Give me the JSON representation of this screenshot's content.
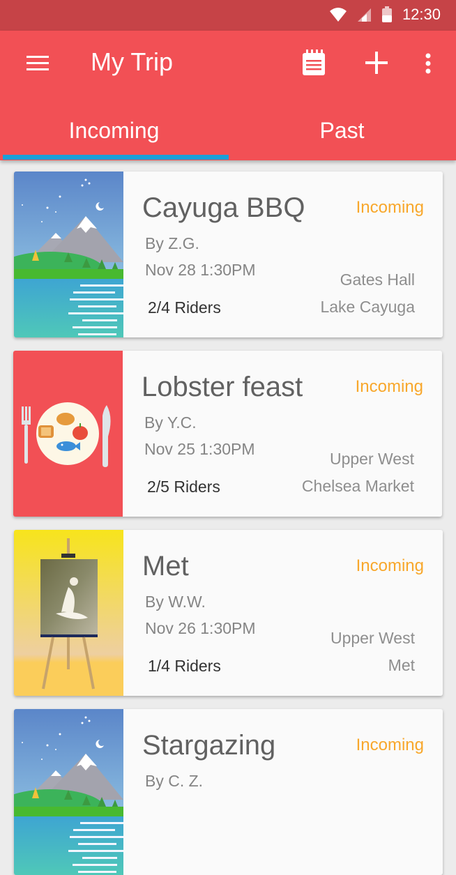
{
  "status_bar": {
    "time": "12:30"
  },
  "app_bar": {
    "title": "My Trip"
  },
  "tabs": [
    {
      "label": "Incoming",
      "selected": true
    },
    {
      "label": "Past",
      "selected": false
    }
  ],
  "trips": [
    {
      "name": "Cayuga BBQ",
      "status": "Incoming",
      "by": "By Z.G.",
      "date": "Nov 28 1:30PM",
      "riders": "2/4 Riders",
      "location_from": "Gates Hall",
      "location_to": "Lake Cayuga",
      "thumbnail": "mountain-lake-icon"
    },
    {
      "name": "Lobster feast",
      "status": "Incoming",
      "by": "By Y.C.",
      "date": "Nov 25 1:30PM",
      "riders": "2/5 Riders",
      "location_from": "Upper West",
      "location_to": "Chelsea Market",
      "thumbnail": "food-plate-icon"
    },
    {
      "name": "Met",
      "status": "Incoming",
      "by": "By W.W.",
      "date": "Nov 26 1:30PM",
      "riders": "1/4 Riders",
      "location_from": "Upper West",
      "location_to": "Met",
      "thumbnail": "easel-painting-icon"
    },
    {
      "name": "Stargazing",
      "status": "Incoming",
      "by": "By C. Z.",
      "date": "",
      "riders": "",
      "location_from": "",
      "location_to": "",
      "thumbnail": "mountain-lake-icon"
    }
  ],
  "colors": {
    "status_bar": "#c64347",
    "app_bar": "#f25055",
    "tab_indicator": "#1a9fd8",
    "status_text": "#f8a72b",
    "background": "#ececec"
  }
}
